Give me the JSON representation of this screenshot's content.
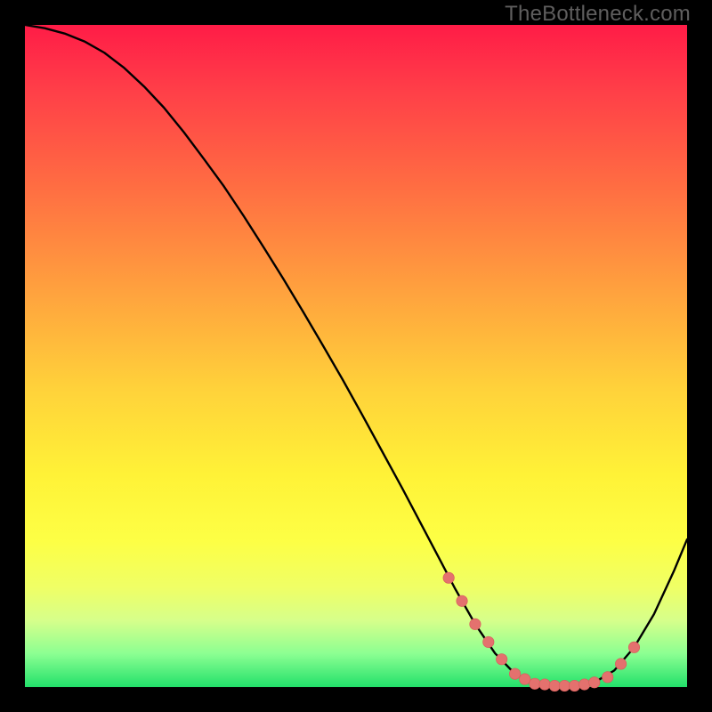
{
  "watermark": "TheBottleneck.com",
  "colors": {
    "background": "#000000",
    "curve_stroke": "#000000",
    "marker_fill": "#e4716e",
    "marker_stroke": "#d85e5b"
  },
  "chart_data": {
    "type": "line",
    "title": "",
    "xlabel": "",
    "ylabel": "",
    "xlim": [
      0,
      100
    ],
    "ylim": [
      0,
      100
    ],
    "x": [
      0,
      3,
      6,
      9,
      12,
      15,
      18,
      21,
      24,
      27,
      30,
      33,
      36,
      39,
      42,
      45,
      48,
      51,
      54,
      57,
      60,
      63,
      65,
      68,
      71,
      74,
      77,
      80,
      83,
      86,
      89,
      92,
      95,
      98,
      100
    ],
    "values": [
      100,
      99.5,
      98.7,
      97.5,
      95.8,
      93.5,
      90.7,
      87.5,
      83.8,
      79.8,
      75.7,
      71.2,
      66.5,
      61.7,
      56.7,
      51.6,
      46.4,
      41.0,
      35.5,
      30.0,
      24.3,
      18.6,
      14.8,
      9.5,
      5.1,
      2.0,
      0.5,
      0.2,
      0.2,
      0.7,
      2.5,
      6.0,
      11.0,
      17.5,
      22.3
    ],
    "markers": {
      "x": [
        64,
        66,
        68,
        70,
        72,
        74,
        75.5,
        77,
        78.5,
        80,
        81.5,
        83,
        84.5,
        86,
        88,
        90,
        92
      ],
      "y": [
        16.5,
        13.0,
        9.5,
        6.8,
        4.2,
        2.0,
        1.2,
        0.5,
        0.4,
        0.2,
        0.2,
        0.2,
        0.4,
        0.7,
        1.5,
        3.5,
        6.0
      ]
    }
  }
}
